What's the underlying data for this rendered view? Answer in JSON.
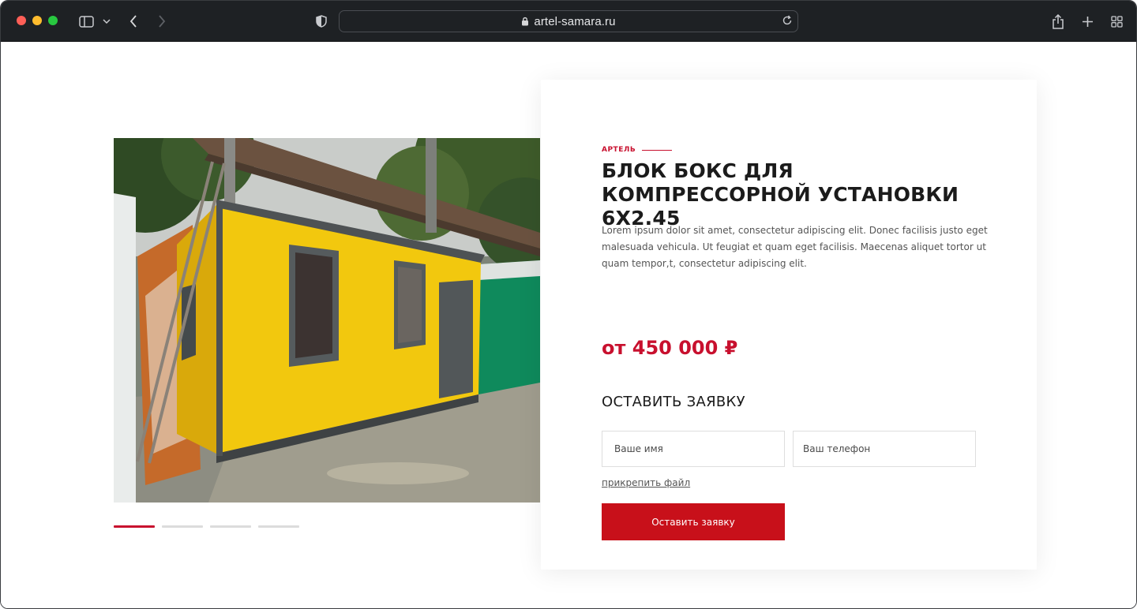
{
  "browser": {
    "url": "artel-samara.ru",
    "icons": [
      "sidebar-icon",
      "chevron-down-icon",
      "back-icon",
      "forward-icon",
      "shield-icon",
      "lock-icon",
      "reload-icon",
      "share-icon",
      "plus-icon",
      "tabs-grid-icon"
    ]
  },
  "product": {
    "brand": "АРТЕЛЬ",
    "title": "БЛОК БОКС ДЛЯ КОМПРЕССОРНОЙ УСТАНОВКИ 6Х2.45",
    "description": "Lorem ipsum dolor sit amet, consectetur adipiscing elit. Donec facilisis justo eget malesuada vehicula. Ut feugiat et quam eget facilisis. Maecenas aliquet tortor ut quam tempor,t, consectetur adipiscing elit.",
    "price": "от 450 000 ₽"
  },
  "gallery": {
    "slide_count": 4,
    "active_index": 0
  },
  "form": {
    "title": "ОСТАВИТЬ ЗАЯВКУ",
    "name_placeholder": "Ваше имя",
    "phone_placeholder": "Ваш телефон",
    "attach_label": "прикрепить файл",
    "submit_label": "Оставить заявку"
  },
  "colors": {
    "accent": "#c8102e",
    "button": "#c8101a",
    "toolbar": "#1e2124"
  }
}
